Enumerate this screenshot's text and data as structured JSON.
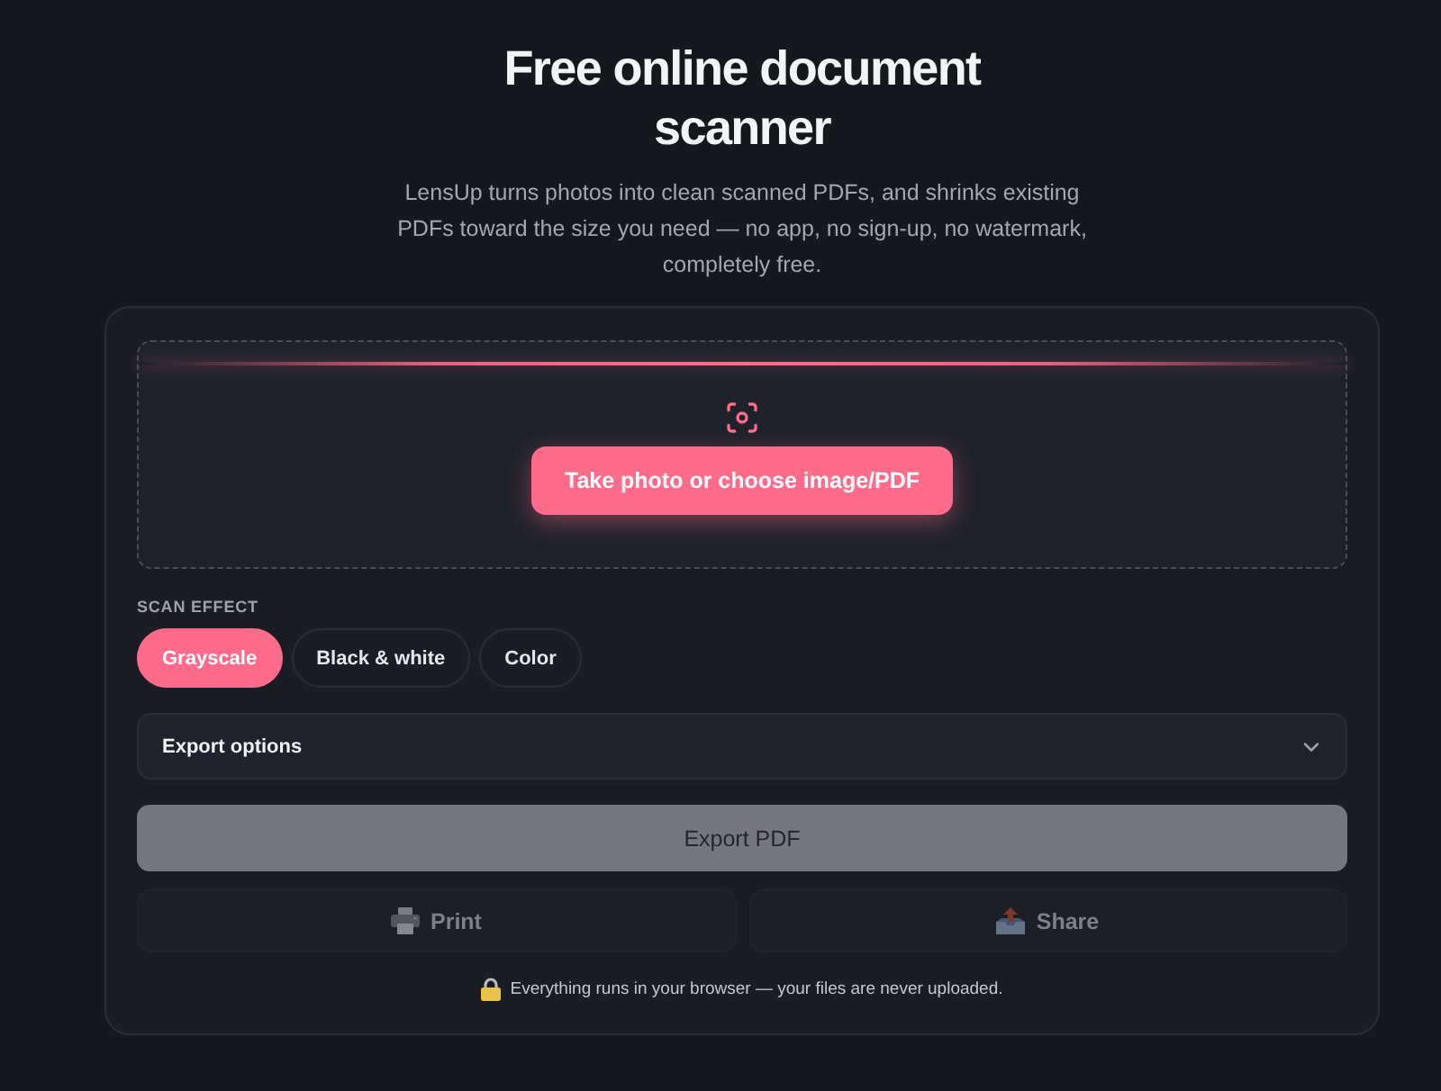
{
  "header": {
    "title": "Free online document scanner",
    "subtitle": "LensUp turns photos into clean scanned PDFs, and shrinks existing PDFs toward the size you need — no app, no sign-up, no watermark, completely free."
  },
  "dropzone": {
    "button": "Take photo or choose image/PDF"
  },
  "scan_effect": {
    "label": "SCAN EFFECT",
    "options": [
      {
        "label": "Grayscale",
        "selected": true
      },
      {
        "label": "Black & white",
        "selected": false
      },
      {
        "label": "Color",
        "selected": false
      }
    ]
  },
  "export_options": {
    "label": "Export options",
    "expanded": false
  },
  "export_button": {
    "label": "Export PDF",
    "disabled": true
  },
  "actions": [
    {
      "kind": "print",
      "label": "Print",
      "disabled": true
    },
    {
      "kind": "share",
      "label": "Share",
      "disabled": true
    }
  ],
  "footer": {
    "note": "Everything runs in your browser — your files are never uploaded."
  }
}
